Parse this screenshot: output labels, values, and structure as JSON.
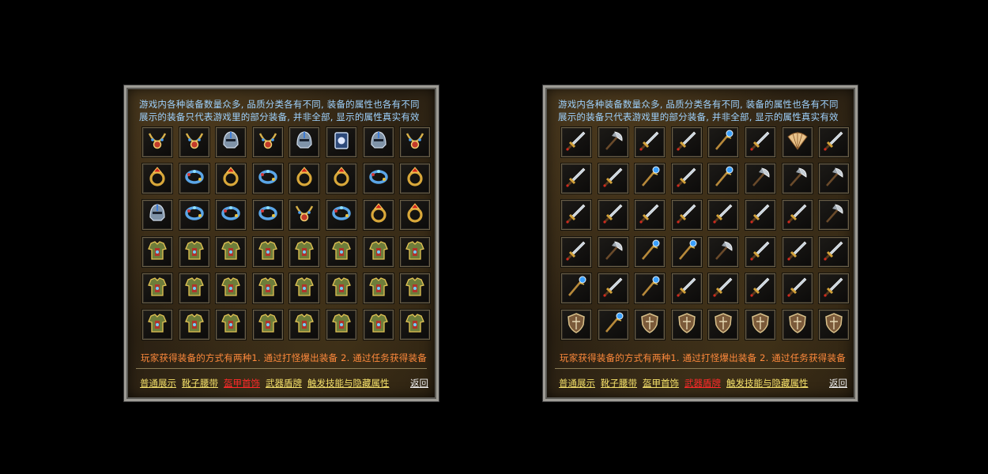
{
  "colors": {
    "intro_text": "#9fd3ff",
    "howto_text": "#ff8a3c",
    "tab_text": "#f4e06a",
    "tab_active": "#ff2a2a",
    "back_text": "#f2f2f2",
    "frame": "#9d9b95"
  },
  "panels": [
    {
      "intro_line1": "游戏内各种装备数量众多, 品质分类各有不同, 装备的属性也各有不同",
      "intro_line2": "展示的装备只代表游戏里的部分装备, 并非全部, 显示的属性真实有效",
      "howto": "玩家获得装备的方式有两种1. 通过打怪爆出装备 2. 通过任务获得装备",
      "tabs": [
        "普通展示",
        "靴子腰带",
        "盔甲首饰",
        "武器盾牌",
        "触发技能与隐藏属性"
      ],
      "active_tab": 2,
      "back": "返回",
      "items": [
        "necklace-icon",
        "necklace-icon",
        "helmet-icon",
        "necklace-icon",
        "helmet-icon",
        "medal-icon",
        "helmet-icon",
        "necklace-icon",
        "ring-icon",
        "bracelet-icon",
        "ring-icon",
        "bracelet-icon",
        "ring-icon",
        "ring-icon",
        "bracelet-icon",
        "ring-icon",
        "helmet-icon",
        "bracelet-icon",
        "bracelet-icon",
        "bracelet-icon",
        "necklace-icon",
        "bracelet-icon",
        "ring-icon",
        "ring-icon",
        "armor-icon",
        "armor-icon",
        "armor-icon",
        "armor-icon",
        "armor-icon",
        "armor-icon",
        "armor-icon",
        "armor-icon",
        "armor-icon",
        "armor-icon",
        "armor-icon",
        "armor-icon",
        "armor-icon",
        "armor-icon",
        "armor-icon",
        "armor-icon",
        "armor-icon",
        "armor-icon",
        "armor-icon",
        "armor-icon",
        "armor-icon",
        "armor-icon",
        "armor-icon",
        "armor-icon"
      ]
    },
    {
      "intro_line1": "游戏内各种装备数量众多, 品质分类各有不同, 装备的属性也各有不同",
      "intro_line2": "展示的装备只代表游戏里的部分装备, 并非全部, 显示的属性真实有效",
      "howto": "玩家获得装备的方式有两种1. 通过打怪爆出装备 2. 通过任务获得装备",
      "tabs": [
        "普通展示",
        "靴子腰带",
        "盔甲首饰",
        "武器盾牌",
        "触发技能与隐藏属性"
      ],
      "active_tab": 3,
      "back": "返回",
      "items": [
        "sword-icon",
        "axe-icon",
        "sword-icon",
        "sword-icon",
        "staff-icon",
        "sword-icon",
        "fan-icon",
        "sword-icon",
        "sword-icon",
        "sword-icon",
        "staff-icon",
        "sword-icon",
        "staff-icon",
        "axe-icon",
        "axe-icon",
        "axe-icon",
        "sword-icon",
        "sword-icon",
        "sword-icon",
        "sword-icon",
        "sword-icon",
        "sword-icon",
        "sword-icon",
        "axe-icon",
        "sword-icon",
        "axe-icon",
        "staff-icon",
        "staff-icon",
        "axe-icon",
        "sword-icon",
        "sword-icon",
        "sword-icon",
        "staff-icon",
        "sword-icon",
        "staff-icon",
        "sword-icon",
        "sword-icon",
        "sword-icon",
        "sword-icon",
        "sword-icon",
        "shield-icon",
        "staff-icon",
        "shield-icon",
        "shield-icon",
        "shield-icon",
        "shield-icon",
        "shield-icon",
        "shield-icon"
      ]
    }
  ]
}
